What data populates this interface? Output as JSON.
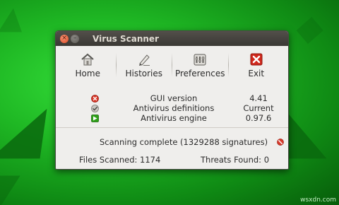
{
  "window": {
    "title": "Virus Scanner"
  },
  "toolbar": {
    "home": {
      "label": "Home",
      "icon": "home-icon"
    },
    "histories": {
      "label": "Histories",
      "icon": "pen-icon"
    },
    "preferences": {
      "label": "Preferences",
      "icon": "preferences-icon"
    },
    "exit": {
      "label": "Exit",
      "icon": "exit-icon"
    }
  },
  "info": [
    {
      "status_icon": "error-icon",
      "name": "GUI version",
      "value": "4.41"
    },
    {
      "status_icon": "check-icon",
      "name": "Antivirus definitions",
      "value": "Current"
    },
    {
      "status_icon": "update-icon",
      "name": "Antivirus engine",
      "value": "0.97.6"
    }
  ],
  "status": {
    "text": "Scanning complete (1329288 signatures)"
  },
  "counts": {
    "files_scanned": "Files Scanned: 1174",
    "threats_found": "Threats Found: 0"
  },
  "watermark": "wsxdn.com",
  "colors": {
    "accent_red": "#d0281c",
    "accent_green": "#2ea018",
    "desktop_green": "#1fb824"
  }
}
